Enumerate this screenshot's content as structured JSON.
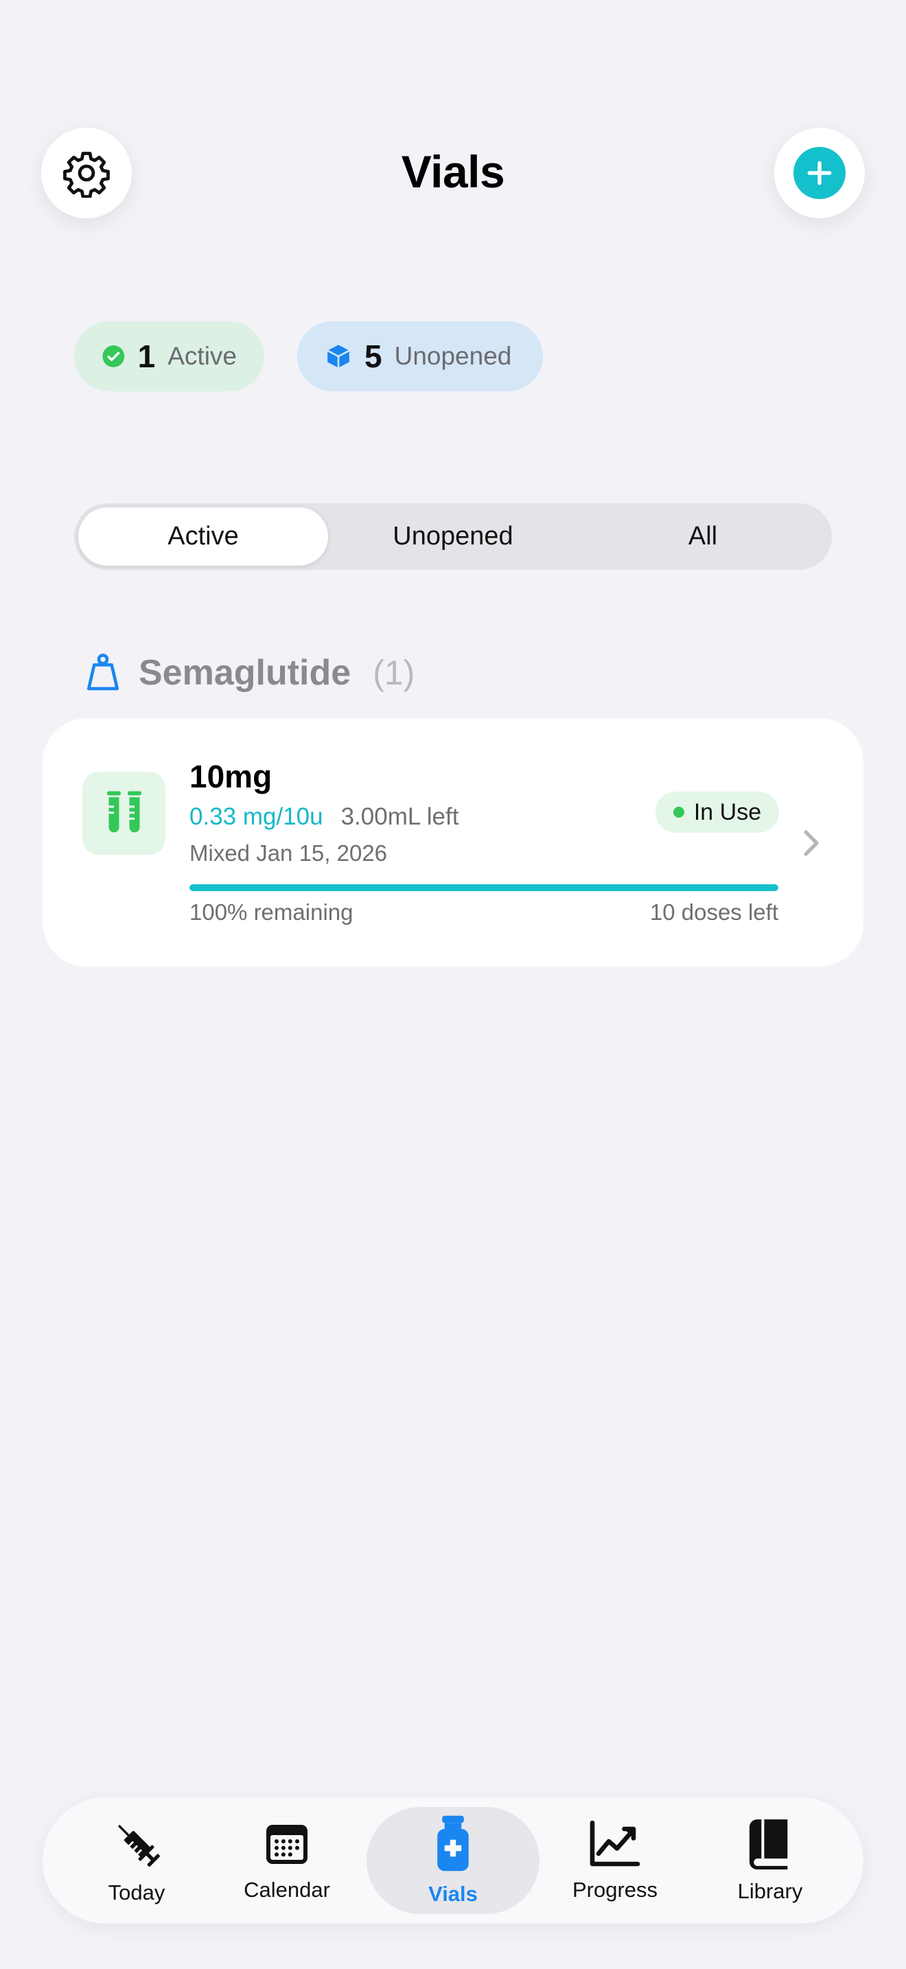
{
  "header": {
    "title": "Vials",
    "settings_icon": "gear-icon",
    "add_icon": "plus-circle-icon"
  },
  "summary": {
    "active_count": "1",
    "active_label": "Active",
    "unopened_count": "5",
    "unopened_label": "Unopened"
  },
  "filter": {
    "options": [
      "Active",
      "Unopened",
      "All"
    ],
    "selected": "Active"
  },
  "groups": [
    {
      "name": "Semaglutide",
      "count": "(1)",
      "icon": "scale-weight-icon",
      "vials": [
        {
          "strength": "10mg",
          "concentration": "0.33 mg/10u",
          "volume_left": "3.00mL left",
          "mixed": "Mixed Jan 15, 2026",
          "status": "In Use",
          "remaining_percent": 100,
          "remaining_label": "100% remaining",
          "doses_left": "10 doses left"
        }
      ]
    }
  ],
  "tabs": [
    {
      "label": "Today",
      "icon": "syringe-icon"
    },
    {
      "label": "Calendar",
      "icon": "calendar-icon"
    },
    {
      "label": "Vials",
      "icon": "vial-icon",
      "selected": true
    },
    {
      "label": "Progress",
      "icon": "chart-line-icon"
    },
    {
      "label": "Library",
      "icon": "book-icon"
    }
  ],
  "colors": {
    "accent": "#14c0cc",
    "active_tab": "#1a86f0",
    "status_green": "#34c759",
    "background": "#f2f2f7"
  }
}
